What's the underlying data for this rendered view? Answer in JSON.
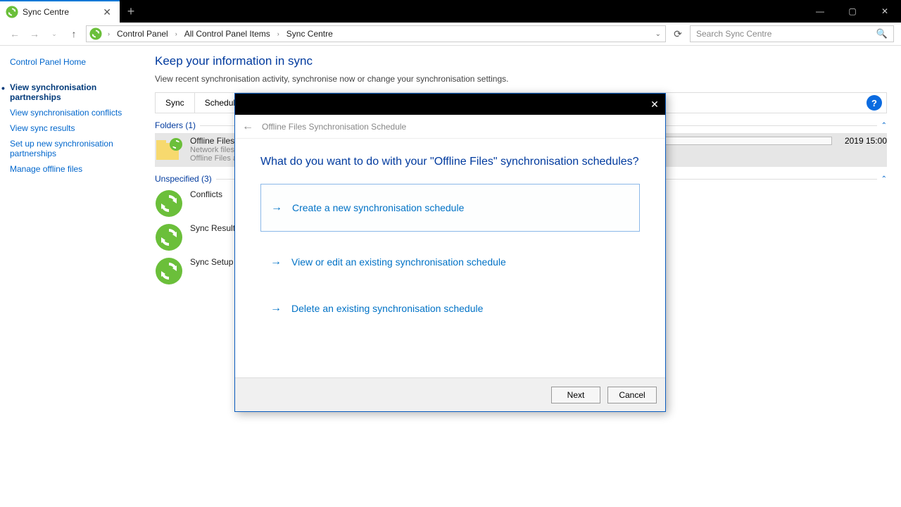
{
  "tab": {
    "title": "Sync Centre"
  },
  "breadcrumb": {
    "items": [
      "Control Panel",
      "All Control Panel Items",
      "Sync Centre"
    ]
  },
  "search": {
    "placeholder": "Search Sync Centre"
  },
  "sidebar": {
    "home": "Control Panel Home",
    "items": [
      "View synchronisation partnerships",
      "View synchronisation conflicts",
      "View sync results",
      "Set up new synchronisation partnerships",
      "Manage offline files"
    ]
  },
  "main": {
    "title": "Keep your information in sync",
    "subtitle": "View recent synchronisation activity, synchronise now or change your synchronisation settings.",
    "tabs": {
      "sync": "Sync",
      "schedule": "Schedule"
    },
    "sections": {
      "folders": "Folders (1)",
      "unspecified": "Unspecified (3)"
    },
    "offline": {
      "title": "Offline Files",
      "line1": "Network files",
      "line2": "Offline Files a",
      "time": "2019 15:00"
    },
    "items": {
      "conflicts": "Conflicts",
      "results": "Sync Results",
      "setup": "Sync Setup"
    }
  },
  "dialog": {
    "header": "Offline Files Synchronisation Schedule",
    "question": "What do you want to do with your \"Offline Files\" synchronisation schedules?",
    "opt1": "Create a new synchronisation schedule",
    "opt2": "View or edit an existing synchronisation schedule",
    "opt3": "Delete an existing synchronisation schedule",
    "next": "Next",
    "cancel": "Cancel"
  }
}
